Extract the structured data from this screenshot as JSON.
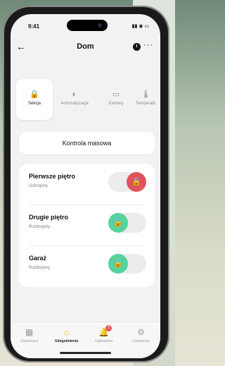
{
  "status": {
    "time": "9:41",
    "icons": "▮▮ ◉ ▭"
  },
  "header": {
    "title": "Dom",
    "back_glyph": "←",
    "more_glyph": "···"
  },
  "tabs": [
    {
      "label": "Sekcja",
      "icon": "lock-icon",
      "glyph": "🔒",
      "active": true
    },
    {
      "label": "Automatyzacja",
      "icon": "toggle-icon",
      "glyph": "◐",
      "active": false
    },
    {
      "label": "Kamery",
      "icon": "camera-icon",
      "glyph": "▭",
      "active": false
    },
    {
      "label": "Temperatu",
      "icon": "thermometer-icon",
      "glyph": "🌡",
      "active": false
    }
  ],
  "mass_control": {
    "label": "Kontrola masowa"
  },
  "sections": [
    {
      "name": "Pierwsze piętro",
      "status": "Uzbrojony",
      "armed": true
    },
    {
      "name": "Drugie piętro",
      "status": "Rozbrojony",
      "armed": false
    },
    {
      "name": "Garaż",
      "status": "Rozbrojony",
      "armed": false
    }
  ],
  "bottom_nav": [
    {
      "label": "Dashboard",
      "icon": "grid-icon",
      "glyph": "▦",
      "active": false
    },
    {
      "label": "Udogodnienia",
      "icon": "home-icon",
      "glyph": "⌂",
      "active": true
    },
    {
      "label": "Ogłoszenia",
      "icon": "bell-icon",
      "glyph": "🔔",
      "badge": "2",
      "active": false
    },
    {
      "label": "Ustawienia",
      "icon": "gear-icon",
      "glyph": "⚙",
      "active": false
    }
  ],
  "colors": {
    "armed": "#e0535d",
    "disarmed": "#58d29d",
    "accent": "#f6b800"
  }
}
